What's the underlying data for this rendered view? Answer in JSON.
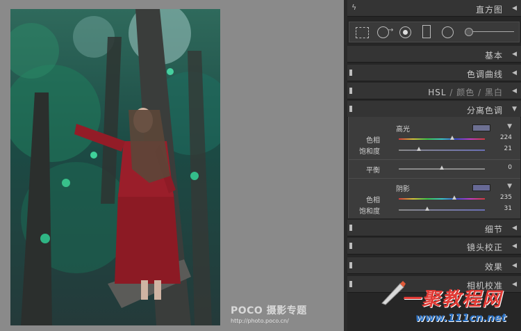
{
  "watermark": {
    "brand": "POCO 摄影专题",
    "url": "http://photo.poco.cn/"
  },
  "panel": {
    "histogram": "直方图",
    "basic": "基本",
    "tone_curve": "色调曲线",
    "hsl": {
      "a": "HSL",
      "sep": "/",
      "b": "颜色",
      "c": "黑白"
    },
    "split_toning": "分离色调",
    "detail": "细节",
    "lens": "镜头校正",
    "effects": "效果",
    "camera": "相机校准"
  },
  "split": {
    "highlights": {
      "title": "高光",
      "hue_label": "色相",
      "hue": "224",
      "sat_label": "饱和度",
      "sat": "21",
      "swatch": "#6d7092"
    },
    "balance": {
      "label": "平衡",
      "value": "0"
    },
    "shadows": {
      "title": "阴影",
      "hue_label": "色相",
      "hue": "235",
      "sat_label": "饱和度",
      "sat": "31",
      "swatch": "#676995"
    }
  },
  "badge": {
    "text": "一聚教程网",
    "url": "www.111cn.net"
  },
  "colors": {
    "panel": "#262626",
    "header": "#343434",
    "canvas": "#8a8a8a"
  },
  "slider_levels": {
    "hl_hue": 0.62,
    "hl_sat": 0.21,
    "balance": 0.5,
    "sh_hue": 0.65,
    "sh_sat": 0.31
  }
}
